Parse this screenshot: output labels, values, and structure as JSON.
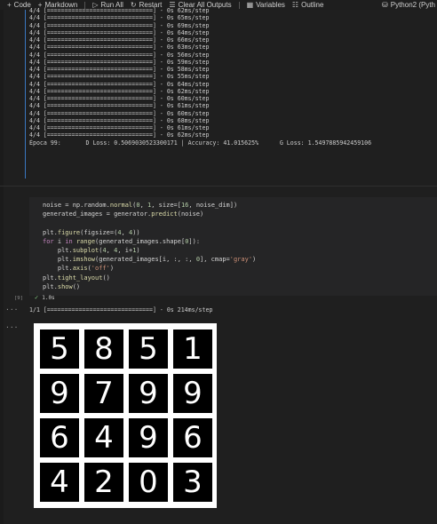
{
  "toolbar": {
    "items": [
      {
        "icon": "plus-icon",
        "glyph": "+",
        "label": "Code"
      },
      {
        "icon": "plus-icon",
        "glyph": "+",
        "label": "Markdown"
      },
      {
        "icon": "run-all-icon",
        "glyph": "▷",
        "label": "Run All"
      },
      {
        "icon": "restart-icon",
        "glyph": "↻",
        "label": "Restart"
      },
      {
        "icon": "clear-outputs-icon",
        "glyph": "☰",
        "label": "Clear All Outputs"
      },
      {
        "icon": "variables-icon",
        "glyph": "▦",
        "label": "Variables"
      },
      {
        "icon": "outline-icon",
        "glyph": "☷",
        "label": "Outline"
      }
    ],
    "kernel": {
      "icon": "kernel-icon",
      "glyph": "⛁",
      "label": "Python2 (Pyth"
    }
  },
  "output1": {
    "lines": [
      "4/4 [==============================] - 0s 62ms/step",
      "4/4 [==============================] - 0s 65ms/step",
      "4/4 [==============================] - 0s 69ms/step",
      "4/4 [==============================] - 0s 64ms/step",
      "4/4 [==============================] - 0s 66ms/step",
      "4/4 [==============================] - 0s 63ms/step",
      "4/4 [==============================] - 0s 56ms/step",
      "4/4 [==============================] - 0s 59ms/step",
      "4/4 [==============================] - 0s 58ms/step",
      "4/4 [==============================] - 0s 55ms/step",
      "4/4 [==============================] - 0s 64ms/step",
      "4/4 [==============================] - 0s 62ms/step",
      "4/4 [==============================] - 0s 60ms/step",
      "4/4 [==============================] - 0s 61ms/step",
      "4/4 [==============================] - 0s 60ms/step",
      "4/4 [==============================] - 0s 68ms/step",
      "4/4 [==============================] - 0s 61ms/step",
      "4/4 [==============================] - 0s 62ms/step",
      "Época 99:       D Loss: 0.5069030523300171 | Accuracy: 41.015625%      G Loss: 1.5497885942459106"
    ]
  },
  "cell": {
    "execution_count": "[9]",
    "status_time": "1.0s",
    "code_lines": [
      "noise = np.random.normal(0, 1, size=[16, noise_dim])",
      "generated_images = generator.predict(noise)",
      "",
      "plt.figure(figsize=(4, 4))",
      "for i in range(generated_images.shape[0]):",
      "    plt.subplot(4, 4, i+1)",
      "    plt.imshow(generated_images[i, :, :, 0], cmap='gray')",
      "    plt.axis('off')",
      "plt.tight_layout()",
      "plt.show()"
    ]
  },
  "output2": {
    "ellipsis": "···",
    "progress": "1/1 [==============================] - 0s 214ms/step"
  },
  "figure": {
    "ellipsis": "···",
    "digits": [
      "5",
      "8",
      "5",
      "1",
      "9",
      "7",
      "9",
      "9",
      "6",
      "4",
      "9",
      "6",
      "4",
      "2",
      "0",
      "3"
    ]
  }
}
